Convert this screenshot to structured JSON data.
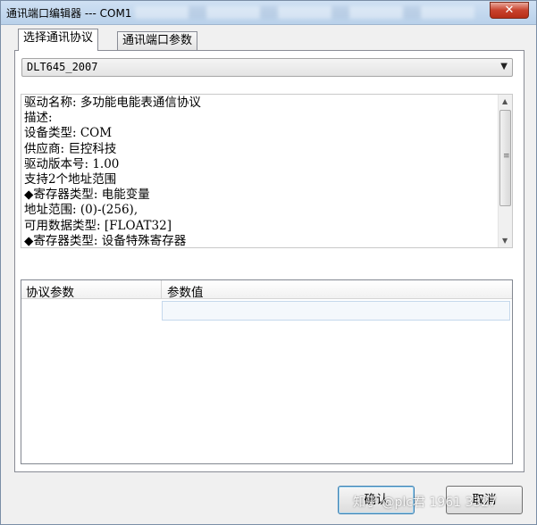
{
  "window": {
    "title": "通讯端口编辑器 --- COM1",
    "close_glyph": "✕"
  },
  "tabs": [
    {
      "label": "选择通讯协议",
      "active": true
    },
    {
      "label": "通讯端口参数",
      "active": false
    }
  ],
  "protocol_select": {
    "value": "DLT645_2007",
    "arrow_icon": "chevron-down-icon"
  },
  "description": {
    "lines": [
      "驱动名称: 多功能电能表通信协议",
      "描述:",
      "设备类型: COM",
      "供应商: 巨控科技",
      "驱动版本号: 1.00",
      "支持2个地址范围",
      "◆寄存器类型: 电能变量",
      "地址范围: (0)-(256),",
      "可用数据类型: [FLOAT32]",
      "◆寄存器类型: 设备特殊寄存器"
    ]
  },
  "param_grid": {
    "columns": [
      "协议参数",
      "参数值"
    ],
    "rows": [
      {
        "param": "",
        "value": ""
      }
    ]
  },
  "buttons": {
    "ok": "确认",
    "cancel": "取消"
  },
  "watermark": "知乎 @plc君 1961 3327",
  "colors": {
    "titlebar": "#b9d1ea",
    "close_button": "#c8412c",
    "panel": "#ffffff",
    "ok_border": "#3c7fb1"
  }
}
